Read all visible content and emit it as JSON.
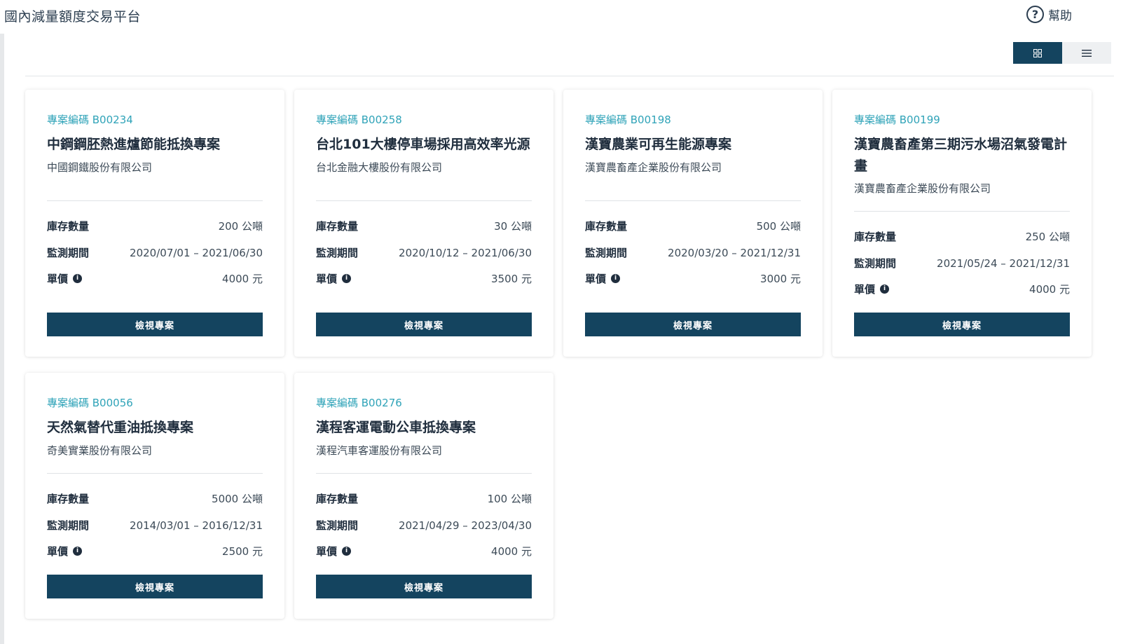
{
  "app": {
    "title": "國內減量額度交易平台"
  },
  "header": {
    "help_label": "幫助"
  },
  "labels": {
    "stock": "庫存數量",
    "period": "監測期間",
    "price": "單價",
    "view_button": "檢視專案"
  },
  "cards": [
    {
      "code": "專案編碼 B00234",
      "title": "中鋼鋼胚熱進爐節能抵換專案",
      "company": "中國鋼鐵股份有限公司",
      "stock": "200 公噸",
      "period": "2020/07/01 – 2021/06/30",
      "price": "4000 元"
    },
    {
      "code": "專案編碼 B00258",
      "title": "台北101大樓停車場採用高效率光源",
      "company": "台北金融大樓股份有限公司",
      "stock": "30 公噸",
      "period": "2020/10/12 – 2021/06/30",
      "price": "3500 元"
    },
    {
      "code": "專案編碼 B00198",
      "title": "漢寶農業可再生能源專案",
      "company": "漢寶農畜產企業股份有限公司",
      "stock": "500 公噸",
      "period": "2020/03/20 – 2021/12/31",
      "price": "3000 元"
    },
    {
      "code": "專案編碼 B00199",
      "title": "漢寶農畜產第三期污水場沼氣發電計畫",
      "company": "漢寶農畜產企業股份有限公司",
      "stock": "250 公噸",
      "period": "2021/05/24 – 2021/12/31",
      "price": "4000 元"
    },
    {
      "code": "專案編碼 B00056",
      "title": "天然氣替代重油抵換專案",
      "company": "奇美實業股份有限公司",
      "stock": "5000 公噸",
      "period": "2014/03/01 – 2016/12/31",
      "price": "2500 元"
    },
    {
      "code": "專案編碼 B00276",
      "title": "漢程客運電動公車抵換專案",
      "company": "漢程汽車客運股份有限公司",
      "stock": "100 公噸",
      "period": "2021/04/29 – 2023/04/30",
      "price": "4000 元"
    }
  ]
}
